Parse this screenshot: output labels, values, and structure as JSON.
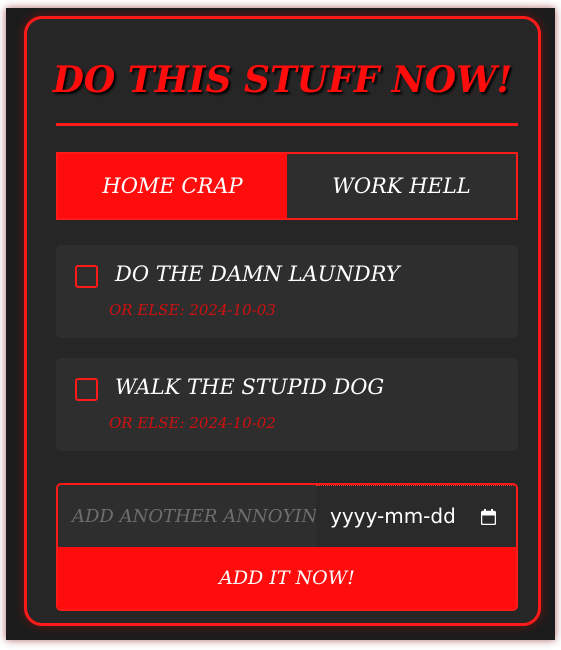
{
  "header": {
    "title": "DO THIS STUFF NOW!"
  },
  "tabs": [
    {
      "label": "HOME CRAP",
      "active": true
    },
    {
      "label": "WORK HELL",
      "active": false
    }
  ],
  "tasks": [
    {
      "text": "DO THE DAMN LAUNDRY",
      "due_label": "OR ELSE:",
      "due_date": "2024-10-03",
      "done": false
    },
    {
      "text": "WALK THE STUPID DOG",
      "due_label": "OR ELSE:",
      "due_date": "2024-10-02",
      "done": false
    }
  ],
  "add_form": {
    "task_placeholder": "ADD ANOTHER ANNOYING TASK",
    "date_placeholder": "yyyy-mm-dd",
    "date_icon": "calendar-icon",
    "submit_label": "ADD IT NOW!"
  },
  "colors": {
    "accent": "#ff0d0d",
    "card_background": "#262626",
    "item_background": "#2e2e2e",
    "text": "#ffffff",
    "due_text": "#d01010"
  }
}
